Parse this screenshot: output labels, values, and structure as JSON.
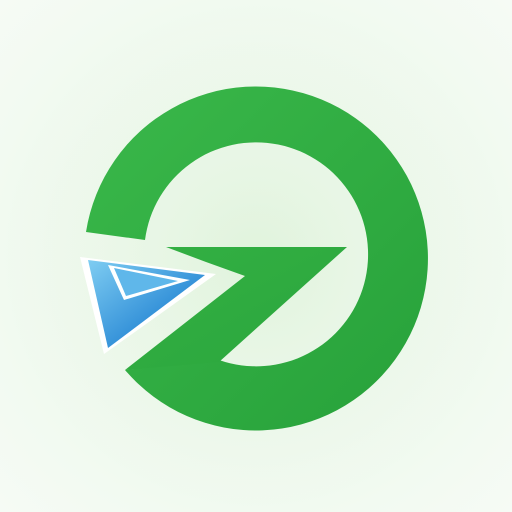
{
  "logo": {
    "icon": "green-ring-z-paper-plane-logo",
    "ring_color": "#2eaa3f",
    "ring_highlight_color": "#3fbf4e",
    "arrow_color_light": "#6cc3ee",
    "arrow_color_dark": "#1a76c8",
    "background_color": "#eaf7e8"
  }
}
